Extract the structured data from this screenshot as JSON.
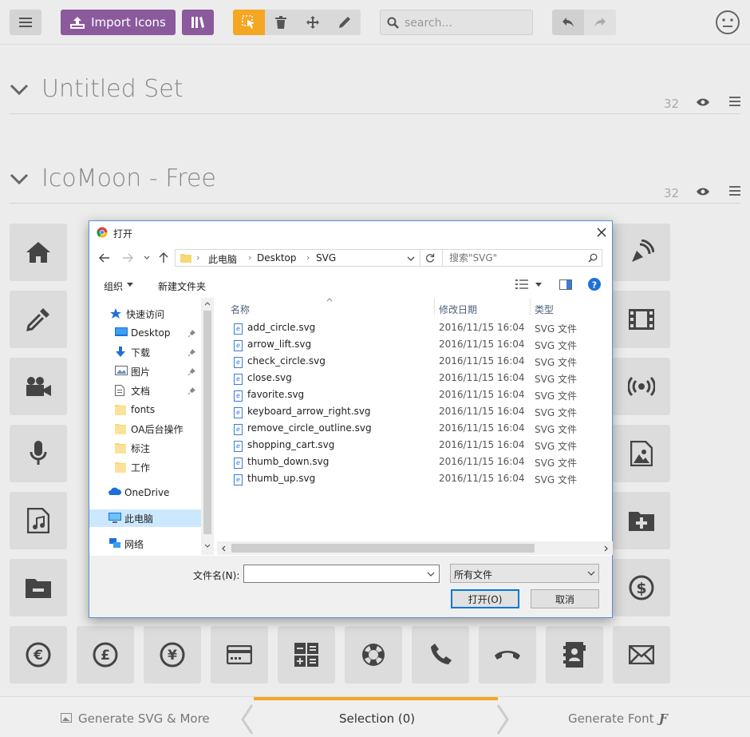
{
  "toolbar": {
    "import_label": "Import Icons",
    "search_placeholder": "search..."
  },
  "sets": [
    {
      "title": "Untitled Set",
      "count": "32"
    },
    {
      "title": "IcoMoon - Free",
      "count": "32"
    }
  ],
  "bottom_bar": {
    "generate_svg": "Generate SVG & More",
    "selection": "Selection (0)",
    "generate_font": "Generate Font",
    "font_glyph": "Ƒ"
  },
  "dialog": {
    "title": "打开",
    "breadcrumb": [
      "此电脑",
      "Desktop",
      "SVG"
    ],
    "search_placeholder": "搜索\"SVG\"",
    "organize": "组织",
    "new_folder": "新建文件夹",
    "nav": [
      {
        "label": "快速访问",
        "icon": "star-icon"
      },
      {
        "label": "Desktop",
        "icon": "desktop-icon",
        "pinned": true
      },
      {
        "label": "下载",
        "icon": "download-icon",
        "pinned": true
      },
      {
        "label": "图片",
        "icon": "pictures-icon",
        "pinned": true
      },
      {
        "label": "文档",
        "icon": "documents-icon",
        "pinned": true
      },
      {
        "label": "fonts",
        "icon": "folder-icon"
      },
      {
        "label": "OA后台操作",
        "icon": "folder-icon"
      },
      {
        "label": "标注",
        "icon": "folder-icon"
      },
      {
        "label": "工作",
        "icon": "folder-icon"
      },
      {
        "label": "OneDrive",
        "icon": "cloud-icon"
      },
      {
        "label": "此电脑",
        "icon": "computer-icon",
        "selected": true
      },
      {
        "label": "网络",
        "icon": "network-icon"
      }
    ],
    "columns": {
      "name": "名称",
      "date": "修改日期",
      "type": "类型"
    },
    "files": [
      {
        "name": "add_circle.svg",
        "date": "2016/11/15 16:04",
        "type": "SVG 文件"
      },
      {
        "name": "arrow_lift.svg",
        "date": "2016/11/15 16:04",
        "type": "SVG 文件"
      },
      {
        "name": "check_circle.svg",
        "date": "2016/11/15 16:04",
        "type": "SVG 文件"
      },
      {
        "name": "close.svg",
        "date": "2016/11/15 16:04",
        "type": "SVG 文件"
      },
      {
        "name": "favorite.svg",
        "date": "2016/11/15 16:04",
        "type": "SVG 文件"
      },
      {
        "name": "keyboard_arrow_right.svg",
        "date": "2016/11/15 16:04",
        "type": "SVG 文件"
      },
      {
        "name": "remove_circle_outline.svg",
        "date": "2016/11/15 16:04",
        "type": "SVG 文件"
      },
      {
        "name": "shopping_cart.svg",
        "date": "2016/11/15 16:04",
        "type": "SVG 文件"
      },
      {
        "name": "thumb_down.svg",
        "date": "2016/11/15 16:04",
        "type": "SVG 文件"
      },
      {
        "name": "thumb_up.svg",
        "date": "2016/11/15 16:04",
        "type": "SVG 文件"
      }
    ],
    "filename_label": "文件名(N):",
    "filename_value": "",
    "filetype_value": "所有文件",
    "open_button": "打开(O)",
    "cancel_button": "取消"
  },
  "colors": {
    "accent_purple": "#8a5a9c",
    "accent_orange": "#f5a623",
    "dialog_border": "#5b8fd6"
  }
}
